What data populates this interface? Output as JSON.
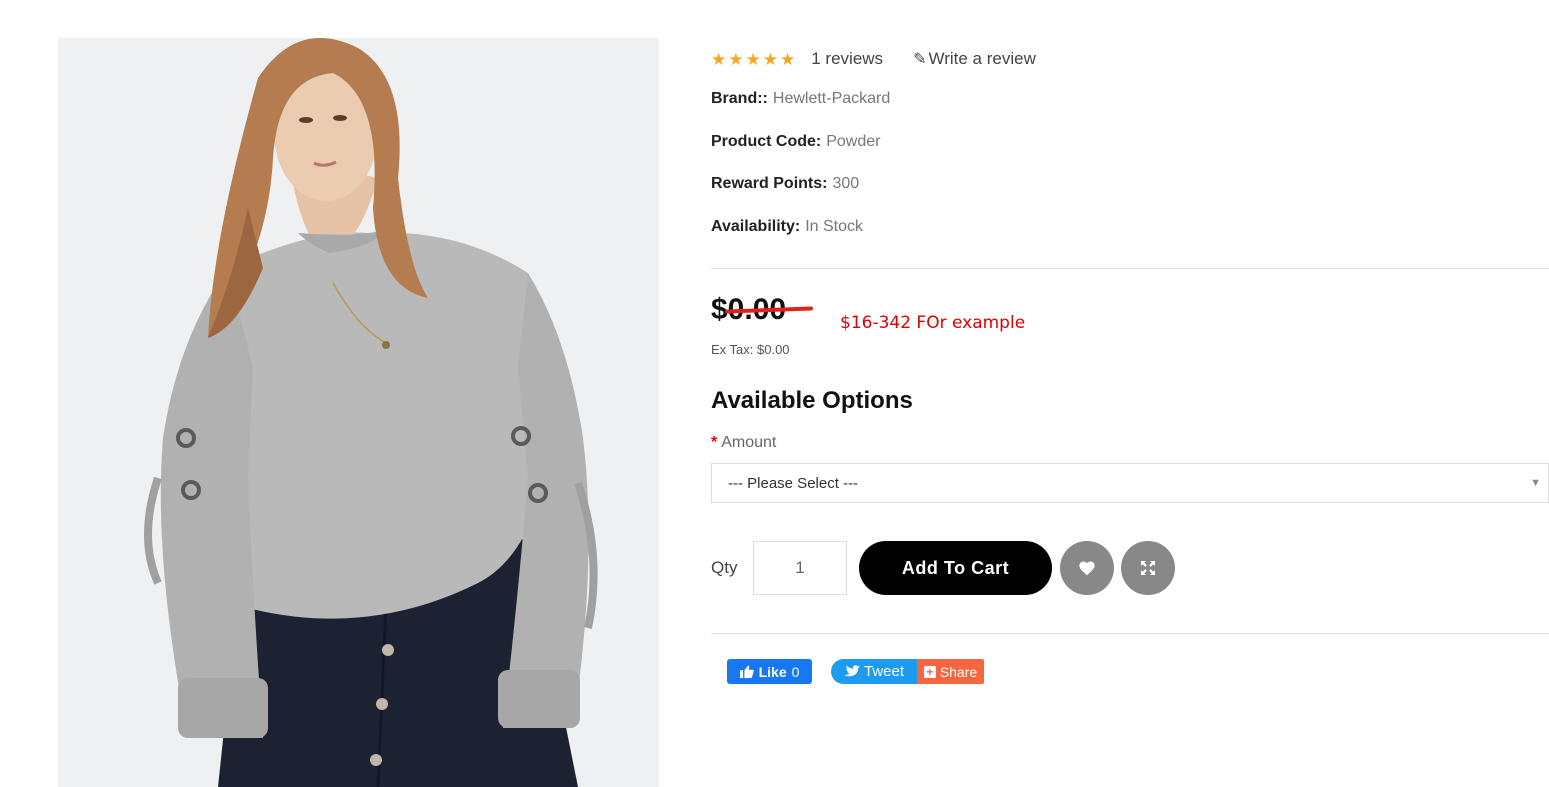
{
  "product": {
    "rating": {
      "value": 5,
      "max": 5,
      "reviews_label": "1 reviews",
      "write_review_label": "Write a review"
    },
    "meta": [
      {
        "label": "Brand::",
        "value": "Hewlett-Packard"
      },
      {
        "label": "Product Code:",
        "value": "Powder"
      },
      {
        "label": "Reward Points:",
        "value": "300"
      },
      {
        "label": "Availability:",
        "value": "In Stock"
      }
    ],
    "price": {
      "old": "$0.00",
      "promo_text": "$16-342 FOr example",
      "ex_tax": "Ex Tax: $0.00"
    },
    "options": {
      "title": "Available Options",
      "amount_label": "Amount",
      "required_mark": "*",
      "select_placeholder": "--- Please Select ---"
    },
    "cart": {
      "qty_label": "Qty",
      "qty_value": "1",
      "add_to_cart_label": "Add To Cart"
    },
    "share": {
      "like_label": "Like",
      "like_count": "0",
      "tweet_label": "Tweet",
      "share_label": "Share"
    }
  },
  "colors": {
    "star": "#f6a623",
    "strike": "#e0211a",
    "promo": "#dd0000",
    "button": "#000000",
    "circle_button": "#888888"
  },
  "icons": [
    "star-icon",
    "pencil-icon",
    "caret-down-icon",
    "heart-icon",
    "expand-icon",
    "thumbs-up-icon",
    "twitter-bird-icon",
    "plus-icon"
  ]
}
